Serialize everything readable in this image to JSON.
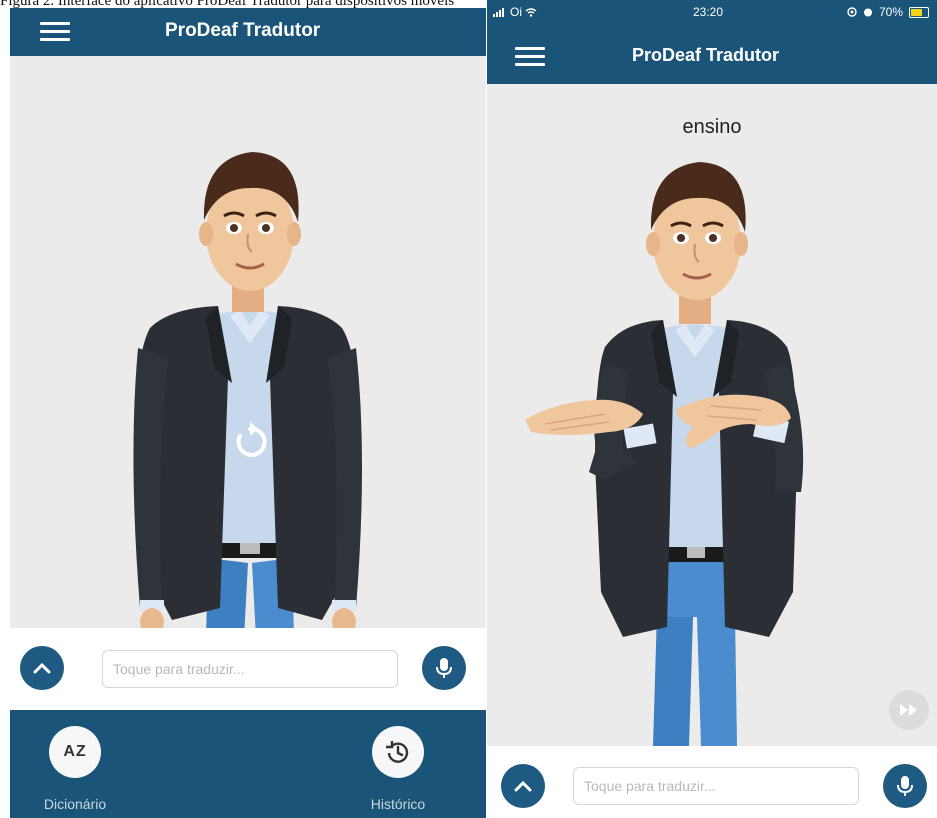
{
  "figure_caption": "Figura 2. Interface do aplicativo ProDeaf Tradutor para dispositivos móveis",
  "left_screen": {
    "app_title": "ProDeaf Tradutor",
    "icons": {
      "menu": "hamburger-menu-icon",
      "replay": "replay-icon",
      "expand": "chevron-up-icon",
      "mic": "microphone-icon"
    },
    "input": {
      "placeholder": "Toque para traduzir...",
      "value": ""
    },
    "bottom_nav": [
      {
        "label": "Dicionário",
        "icon": "az-dictionary-icon",
        "icon_text": "AZ"
      },
      {
        "label": "Histórico",
        "icon": "history-clock-icon"
      }
    ]
  },
  "right_screen": {
    "status_bar": {
      "carrier": "Oi",
      "time": "23:20",
      "battery": "70%",
      "battery_level": 0.7
    },
    "app_title": "ProDeaf Tradutor",
    "sign_word": "ensino",
    "icons": {
      "menu": "hamburger-menu-icon",
      "fast_forward": "fast-forward-icon",
      "expand": "chevron-up-icon",
      "mic": "microphone-icon"
    },
    "input": {
      "placeholder": "Toque para traduzir...",
      "value": ""
    }
  },
  "colors": {
    "primary": "#1b5479",
    "button": "#1f5a82",
    "background": "#ebebeb",
    "battery": "#f2d21b"
  }
}
